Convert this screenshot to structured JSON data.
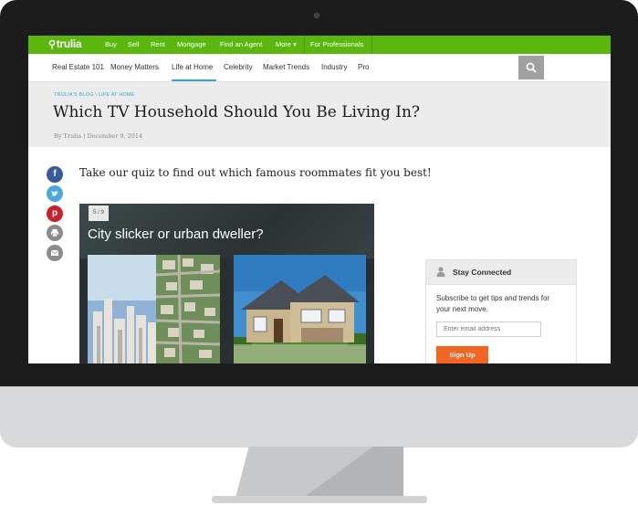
{
  "topnav": {
    "logo": "trulia",
    "items": [
      "Buy",
      "Sell",
      "Rent",
      "Mortgage",
      "Find an Agent",
      "More ▾",
      "For Professionals"
    ]
  },
  "subnav": {
    "items": [
      "Real Estate 101",
      "Money Matters",
      "Life at Home",
      "Celebrity",
      "Market Trends",
      "Industry",
      "Pro"
    ],
    "active": "Life at Home"
  },
  "article": {
    "breadcrumb": "TRULIA'S BLOG \\ LIFE AT HOME",
    "title": "Which TV Household Should You Be Living In?",
    "byline": "By Trulia | December 9, 2014",
    "intro": "Take our quiz to find out which famous roommates fit you best!"
  },
  "quiz": {
    "counter": "5 / 9",
    "question": "City slicker or urban dweller?"
  },
  "sidebar": {
    "title": "Stay Connected",
    "description": "Subscribe to get tips and trends for your next move.",
    "email_placeholder": "Enter email address",
    "button": "Sign Up"
  },
  "colors": {
    "brand": "#5bb70d",
    "accent": "#2fa8cf",
    "cta": "#f26522"
  },
  "icons": [
    "facebook-icon",
    "twitter-icon",
    "pinterest-icon",
    "print-icon",
    "email-icon",
    "search-icon",
    "user-icon"
  ]
}
